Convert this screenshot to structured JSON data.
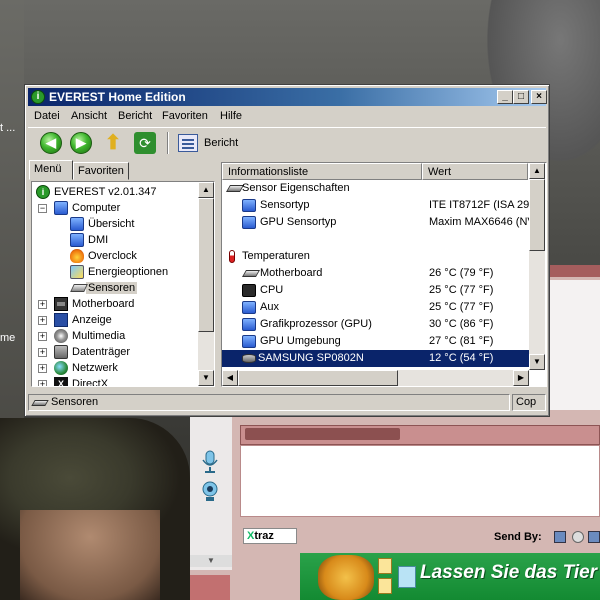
{
  "desktop": {
    "left_labels": [
      "t ...",
      "me",
      "t"
    ]
  },
  "window": {
    "title": "EVEREST Home Edition",
    "controls": {
      "minimize": "_",
      "maximize": "□",
      "close": "×"
    }
  },
  "menu": [
    "Datei",
    "Ansicht",
    "Bericht",
    "Favoriten",
    "Hilfe"
  ],
  "toolbar": {
    "back_icon": "back-arrow-icon",
    "forward_icon": "forward-arrow-icon",
    "up_icon": "up-arrow-icon",
    "refresh_icon": "refresh-icon",
    "report_label": "Bericht"
  },
  "tabs": [
    "Menü",
    "Favoriten"
  ],
  "tree": [
    {
      "label": "EVEREST v2.01.347",
      "icon": "everest-icon",
      "level": 0,
      "expander": ""
    },
    {
      "label": "Computer",
      "icon": "computer-icon",
      "level": 1,
      "expander": "−"
    },
    {
      "label": "Übersicht",
      "icon": "computer-icon",
      "level": 2,
      "expander": ""
    },
    {
      "label": "DMI",
      "icon": "computer-icon",
      "level": 2,
      "expander": ""
    },
    {
      "label": "Overclock",
      "icon": "flame-icon",
      "level": 2,
      "expander": ""
    },
    {
      "label": "Energieoptionen",
      "icon": "energy-icon",
      "level": 2,
      "expander": ""
    },
    {
      "label": "Sensoren",
      "icon": "sensor-icon",
      "level": 2,
      "expander": "",
      "selected": true
    },
    {
      "label": "Motherboard",
      "icon": "motherboard-icon",
      "level": 1,
      "expander": "+"
    },
    {
      "label": "Anzeige",
      "icon": "display-icon",
      "level": 1,
      "expander": "+"
    },
    {
      "label": "Multimedia",
      "icon": "multimedia-icon",
      "level": 1,
      "expander": "+"
    },
    {
      "label": "Datenträger",
      "icon": "disk-icon",
      "level": 1,
      "expander": "+"
    },
    {
      "label": "Netzwerk",
      "icon": "network-icon",
      "level": 1,
      "expander": "+"
    },
    {
      "label": "DirectX",
      "icon": "directx-icon",
      "level": 1,
      "expander": "+"
    }
  ],
  "list": {
    "columns": [
      "Informationsliste",
      "Wert"
    ],
    "rows": [
      {
        "type": "group",
        "name": "Sensor Eigenschaften",
        "value": "",
        "icon": "sensor-icon"
      },
      {
        "type": "item",
        "name": "Sensortyp",
        "value": "ITE IT8712F  (ISA 29",
        "icon": "aux-icon"
      },
      {
        "type": "item",
        "name": "GPU Sensortyp",
        "value": "Maxim MAX6646  (NV",
        "icon": "aux-icon"
      },
      {
        "type": "blank",
        "name": "",
        "value": ""
      },
      {
        "type": "group",
        "name": "Temperaturen",
        "value": "",
        "icon": "thermometer-icon"
      },
      {
        "type": "item",
        "name": "Motherboard",
        "value": "26 °C  (79 °F)",
        "icon": "motherboard-icon"
      },
      {
        "type": "item",
        "name": "CPU",
        "value": "25 °C  (77 °F)",
        "icon": "cpu-icon"
      },
      {
        "type": "item",
        "name": "Aux",
        "value": "25 °C  (77 °F)",
        "icon": "aux-icon"
      },
      {
        "type": "item",
        "name": "Grafikprozessor (GPU)",
        "value": "30 °C  (86 °F)",
        "icon": "aux-icon"
      },
      {
        "type": "item",
        "name": "GPU Umgebung",
        "value": "27 °C  (81 °F)",
        "icon": "aux-icon"
      },
      {
        "type": "item",
        "name": "SAMSUNG SP0802N",
        "value": "12 °C  (54 °F)",
        "icon": "hdd-icon",
        "selected": true
      }
    ]
  },
  "statusbar": {
    "left": "Sensoren",
    "right": "Cop"
  },
  "messenger": {
    "xtraz_label": "traz",
    "xtraz_prefix": "X",
    "send_by_label": "Send By:",
    "ad_text": "Lassen Sie das Tier"
  }
}
